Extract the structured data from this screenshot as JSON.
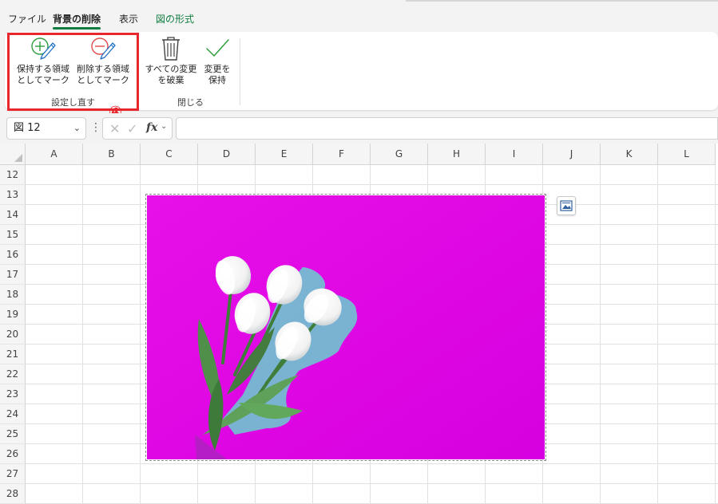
{
  "tabs": {
    "file": "ファイル",
    "remove_bg": "背景の削除",
    "view": "表示",
    "picture_format": "図の形式"
  },
  "ribbon": {
    "mark_keep": "保持する領域\nとしてマーク",
    "mark_remove": "削除する領域\nとしてマーク",
    "discard_all": "すべての変更\nを破棄",
    "keep_changes": "変更を\n保持",
    "group_refine": "設定し直す",
    "group_close": "閉じる"
  },
  "annotation": {
    "step": "④",
    "color": "#e8262d"
  },
  "formula_bar": {
    "name_box": "図 12",
    "fx": "fx",
    "formula": ""
  },
  "grid": {
    "columns": [
      "A",
      "B",
      "C",
      "D",
      "E",
      "F",
      "G",
      "H",
      "I",
      "J",
      "K",
      "L"
    ],
    "rows": [
      "12",
      "13",
      "14",
      "15",
      "16",
      "17",
      "18",
      "19",
      "20",
      "21",
      "22",
      "23",
      "24",
      "25",
      "26",
      "27",
      "28"
    ]
  },
  "picture": {
    "background_color": "#e600e6",
    "subject": "white tulips bouquet"
  },
  "colors": {
    "accent_green": "#107c41",
    "highlight_red": "#e8262d",
    "keep_icon": "#2e9e3e",
    "remove_icon": "#e04a4a"
  }
}
